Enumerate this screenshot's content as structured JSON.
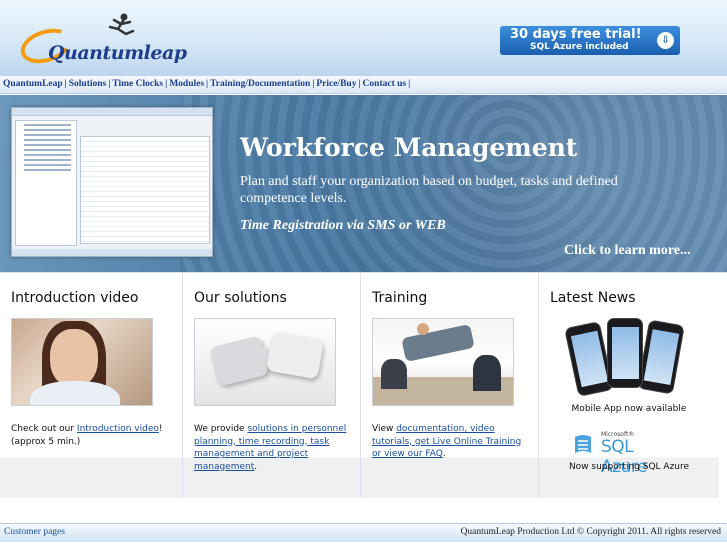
{
  "header": {
    "logo_text": "Quantumleap",
    "trial_title": "30 days free trial!",
    "trial_subtitle": "SQL Azure included",
    "trial_icon": "download-arrow-icon"
  },
  "nav": {
    "items": [
      "QuantumLeap",
      "Solutions",
      "Time Clocks",
      "Modules",
      "Training/Documentation",
      "Price/Buy",
      "Contact us"
    ],
    "separator": "|"
  },
  "banner": {
    "title": "Workforce Management",
    "description": "Plan and staff your organization based on budget, tasks and defined competence levels.",
    "tagline": "Time Registration via SMS or WEB",
    "cta": "Click to learn more..."
  },
  "columns": {
    "intro": {
      "title": "Introduction video",
      "text_before": "Check out our ",
      "link": "Introduction video",
      "text_after": "! (approx 5 min.)"
    },
    "solutions": {
      "title": "Our solutions",
      "text_before": "We provide ",
      "link": "solutions in personnel planning, time recording, task management and project management",
      "text_after": "."
    },
    "training": {
      "title": "Training",
      "text_before": "View ",
      "link": "documentation, video tutorials, get Live Online Training or view our FAQ",
      "text_after": "."
    },
    "news": {
      "title": "Latest News",
      "item1": "Mobile App now available",
      "azure_ms": "Microsoft®",
      "azure_brand": "SQL Azure",
      "item2": "Now supporting SQL Azure"
    }
  },
  "footer": {
    "left_link": "Customer pages",
    "copyright": "QuantumLeap Production Ltd © Copyright 2011. All rights reserved"
  }
}
